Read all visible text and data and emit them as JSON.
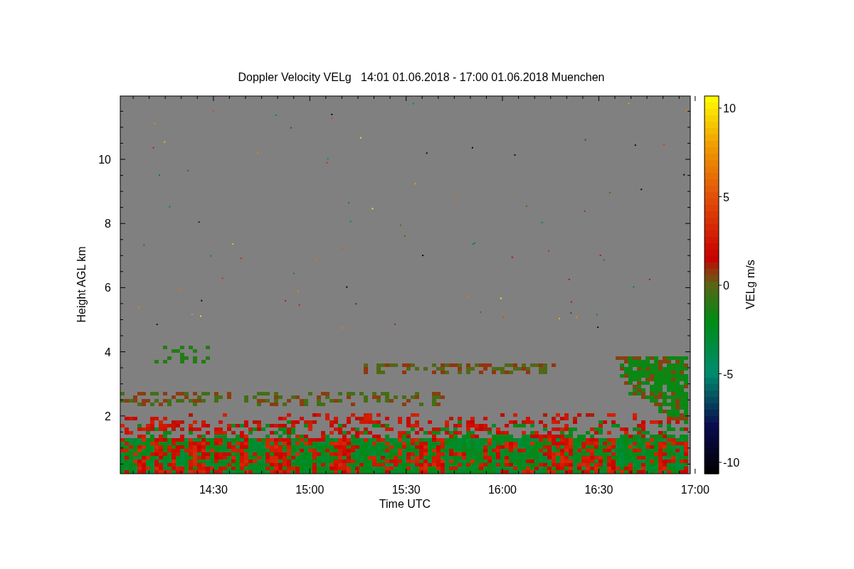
{
  "title": "Doppler Velocity VELg   14:01 01.06.2018 - 17:00 01.06.2018 Muenchen",
  "y_axis": {
    "label": "Height AGL km",
    "ticks": [
      "10",
      "8",
      "6",
      "4",
      "2"
    ]
  },
  "x_axis": {
    "label": "Time UTC",
    "ticks": [
      "14:30",
      "15:00",
      "15:30",
      "16:00",
      "16:30",
      "17:00"
    ]
  },
  "colorbar": {
    "label": "VELg m/s",
    "ticks": [
      "10",
      "5",
      "0",
      "-5",
      "-10"
    ]
  }
}
